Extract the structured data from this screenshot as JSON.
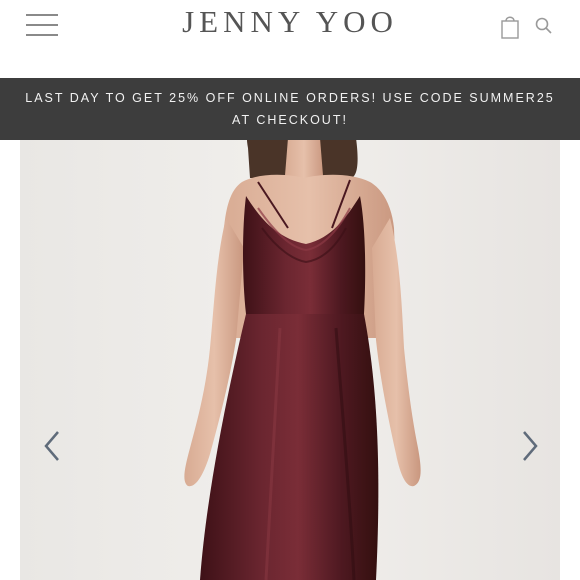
{
  "header": {
    "brand": "JENNY YOO",
    "icons": {
      "menu": "menu-icon",
      "bag": "shopping-bag-icon",
      "search": "search-icon"
    }
  },
  "promo": {
    "text": "LAST DAY TO GET 25% OFF ONLINE ORDERS! USE CODE SUMMER25 AT CHECKOUT!"
  },
  "carousel": {
    "prev_icon": "chevron-left-icon",
    "next_icon": "chevron-right-icon"
  },
  "colors": {
    "banner_bg": "#3d3d3d",
    "brand_text": "#555555",
    "dress": "#5a1f27",
    "backdrop": "#efedea",
    "arrow": "#5f6b7a"
  }
}
